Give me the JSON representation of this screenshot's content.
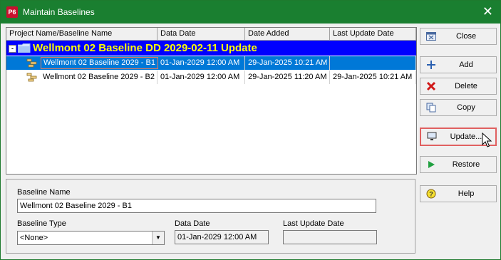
{
  "window": {
    "title": "Maintain Baselines",
    "app_icon_text": "P6",
    "close_symbol": "✕"
  },
  "grid": {
    "columns": [
      "Project Name/Baseline Name",
      "Data Date",
      "Date Added",
      "Last Update Date"
    ],
    "group": {
      "expander": "-",
      "label": "Wellmont 02 Baseline DD 2029-02-11 Update"
    },
    "rows": [
      {
        "name": "Wellmont 02 Baseline 2029 - B1",
        "data_date": "01-Jan-2029 12:00 AM",
        "date_added": "29-Jan-2025 10:21 AM",
        "last_update": ""
      },
      {
        "name": "Wellmont 02 Baseline 2029 - B2",
        "data_date": "01-Jan-2029 12:00 AM",
        "date_added": "29-Jan-2025 11:20 AM",
        "last_update": "29-Jan-2025 10:21 AM"
      }
    ]
  },
  "buttons": {
    "close": "Close",
    "add": "Add",
    "delete": "Delete",
    "copy": "Copy",
    "update": "Update...",
    "restore": "Restore",
    "help": "Help"
  },
  "icons": {
    "close": "close-dialog-icon",
    "add": "plus-icon",
    "delete": "red-x-icon",
    "copy": "copy-icon",
    "update": "monitor-icon",
    "restore": "play-icon",
    "help": "question-icon"
  },
  "details": {
    "baseline_name_label": "Baseline Name",
    "baseline_name_value": "Wellmont 02 Baseline 2029 - B1",
    "baseline_type_label": "Baseline Type",
    "baseline_type_value": "<None>",
    "data_date_label": "Data Date",
    "data_date_value": "01-Jan-2029 12:00 AM",
    "last_update_label": "Last Update Date",
    "last_update_value": ""
  },
  "colors": {
    "title_bar": "#1a7f30",
    "group_row_bg": "#0000ff",
    "group_row_text": "#ffff00",
    "selected_row": "#0078d7",
    "highlight_border": "#e06060"
  }
}
